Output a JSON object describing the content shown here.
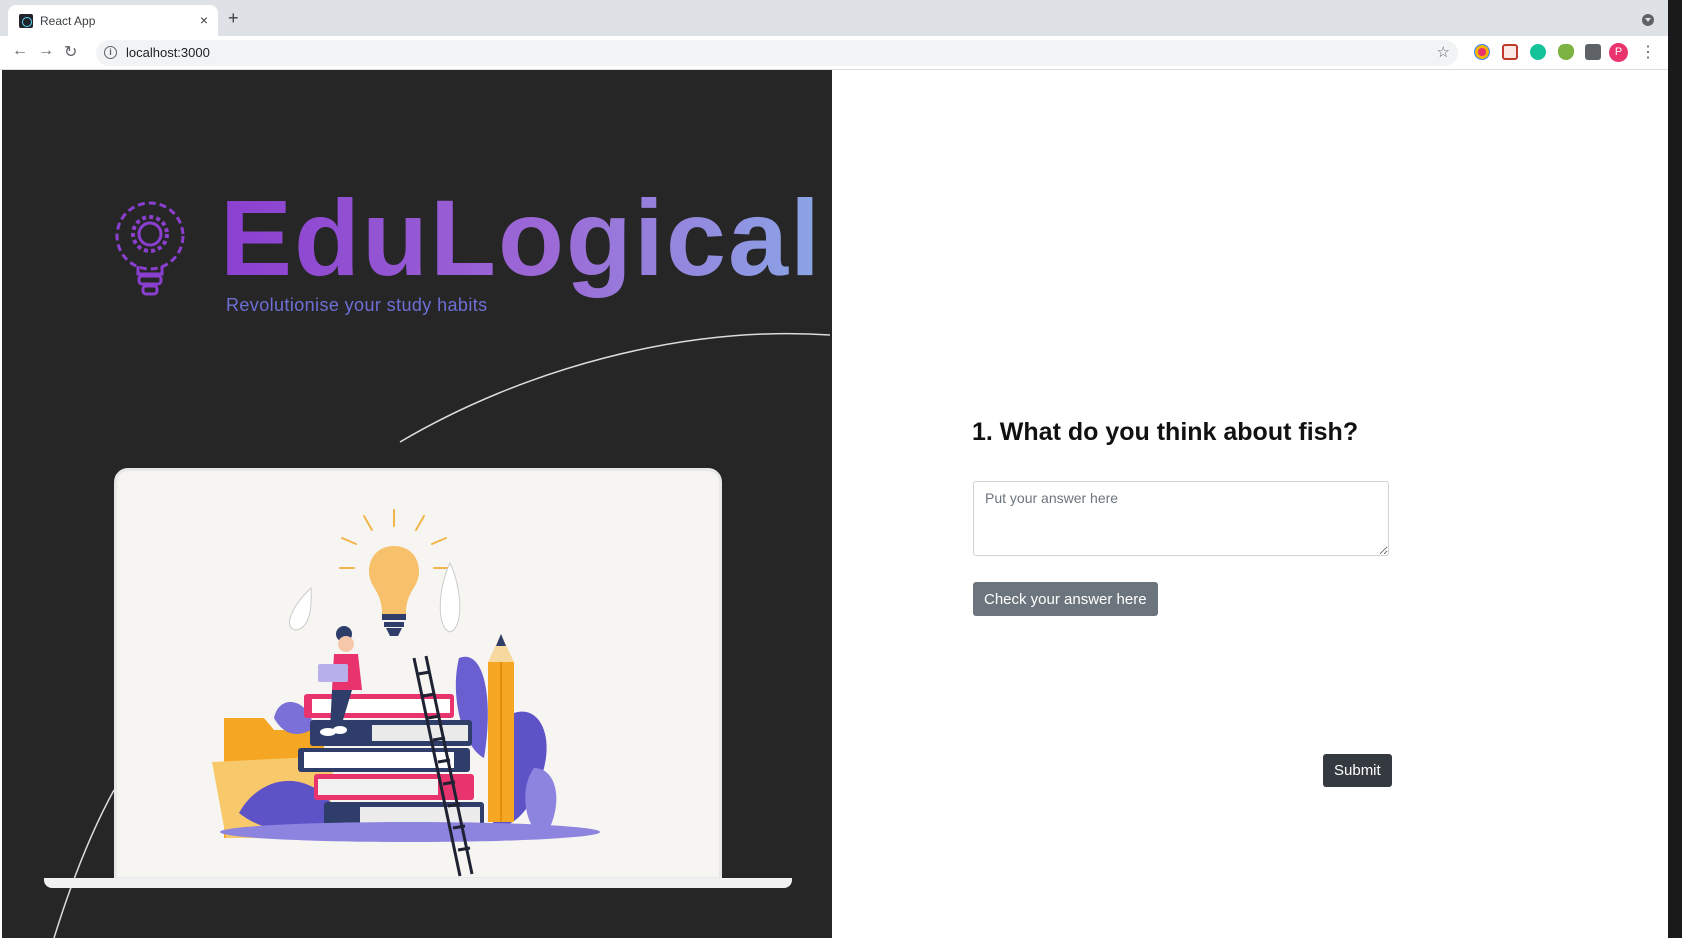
{
  "browser": {
    "tab_title": "React App",
    "tab_close": "×",
    "new_tab": "+",
    "url": "localhost:3000",
    "profile_initial": "P",
    "back": "←",
    "forward": "→",
    "reload": "↻",
    "star": "☆",
    "menu": "⋮"
  },
  "brand": {
    "title": "EduLogical",
    "tagline": "Revolutionise your study habits",
    "colors": {
      "purple": "#8b3fd0",
      "lavender": "#9c6ad6",
      "blue": "#8aa6e6",
      "tagline": "#6e6fd6",
      "panel": "#262626"
    }
  },
  "question": {
    "title": "1. What do you think about fish?",
    "answer_placeholder": "Put your answer here",
    "answer_value": "",
    "check_label": "Check your answer here"
  },
  "form": {
    "submit_label": "Submit"
  },
  "icons": {
    "logo": "lightbulb-gear-icon",
    "illustration": "books-lightbulb-illustration"
  }
}
